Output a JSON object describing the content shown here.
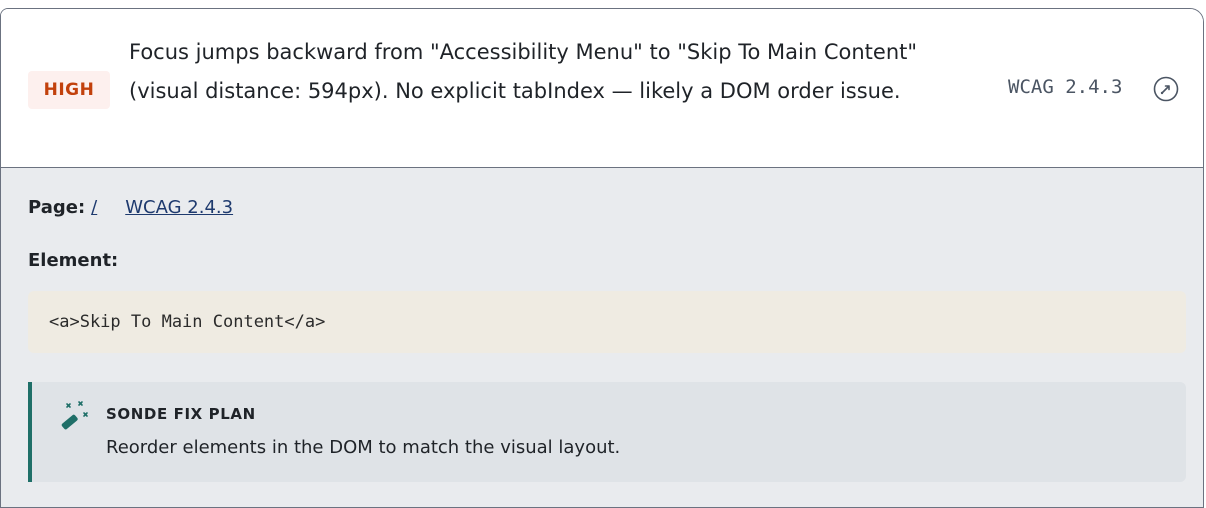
{
  "issue": {
    "severity": "HIGH",
    "description": "Focus jumps backward from \"Accessibility Menu\" to \"Skip To Main Content\" (visual distance: 594px). No explicit tabIndex — likely a DOM order issue.",
    "wcag_code": "WCAG 2.4.3",
    "help_icon": "help-circle-icon"
  },
  "details": {
    "page_label": "Page:",
    "page_value": "/",
    "wcag_link": "WCAG 2.4.3",
    "element_label": "Element:",
    "element_code": "<a>Skip To Main Content</a>"
  },
  "fix_plan": {
    "icon": "magic-wand-icon",
    "title": "SONDE FIX PLAN",
    "text": "Reorder elements in the DOM to match the visual layout."
  },
  "colors": {
    "severity_text": "#c2410c",
    "severity_bg": "#fdf0ee",
    "link": "#1e3a6e",
    "fix_accent": "#1f6f68",
    "body_bg": "#e9ebee",
    "code_bg": "#efebe2"
  }
}
